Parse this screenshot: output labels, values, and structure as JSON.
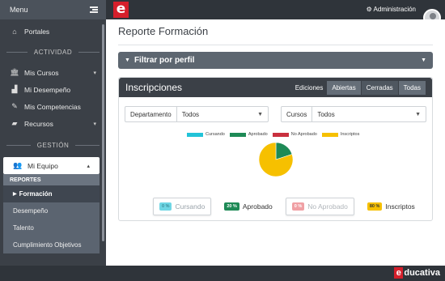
{
  "sidebar": {
    "menu_label": "Menu",
    "portales": "Portales",
    "section_actividad": "ACTIVIDAD",
    "items": [
      {
        "label": "Mis Cursos"
      },
      {
        "label": "Mi Desempeño"
      },
      {
        "label": "Mis Competencias"
      },
      {
        "label": "Recursos"
      }
    ],
    "section_gestion": "GESTIÓN",
    "team": "Mi Equipo",
    "reportes": "REPORTES",
    "sub_items": [
      {
        "label": "Formación"
      },
      {
        "label": "Desempeño"
      },
      {
        "label": "Talento"
      },
      {
        "label": "Cumplimiento Objetivos"
      }
    ]
  },
  "topbar": {
    "logo": "e",
    "admin": "Administración"
  },
  "main": {
    "title": "Reporte Formación",
    "filter": "Filtrar por perfil"
  },
  "card": {
    "title": "Inscripciones",
    "ediciones_label": "Ediciones",
    "seg": [
      "Abiertas",
      "Cerradas",
      "Todas"
    ],
    "dept_label": "Departamento",
    "dept_value": "Todos",
    "cursos_label": "Cursos",
    "cursos_value": "Todos"
  },
  "chart_data": {
    "type": "pie",
    "labels": [
      "Cursando",
      "Aprobado",
      "No Aprobado",
      "Inscriptos"
    ],
    "values": [
      0,
      20,
      0,
      80
    ],
    "colors": [
      "#22c3d8",
      "#1e8a56",
      "#c9303e",
      "#f6c000"
    ]
  },
  "stats": [
    {
      "badge": "0 %",
      "label": "Cursando"
    },
    {
      "badge": "20 %",
      "label": "Aprobado"
    },
    {
      "badge": "0 %",
      "label": "No Aprobado"
    },
    {
      "badge": "80 %",
      "label": "Inscriptos"
    }
  ],
  "footer": {
    "brand_e": "e",
    "brand_rest": "ducativa"
  }
}
